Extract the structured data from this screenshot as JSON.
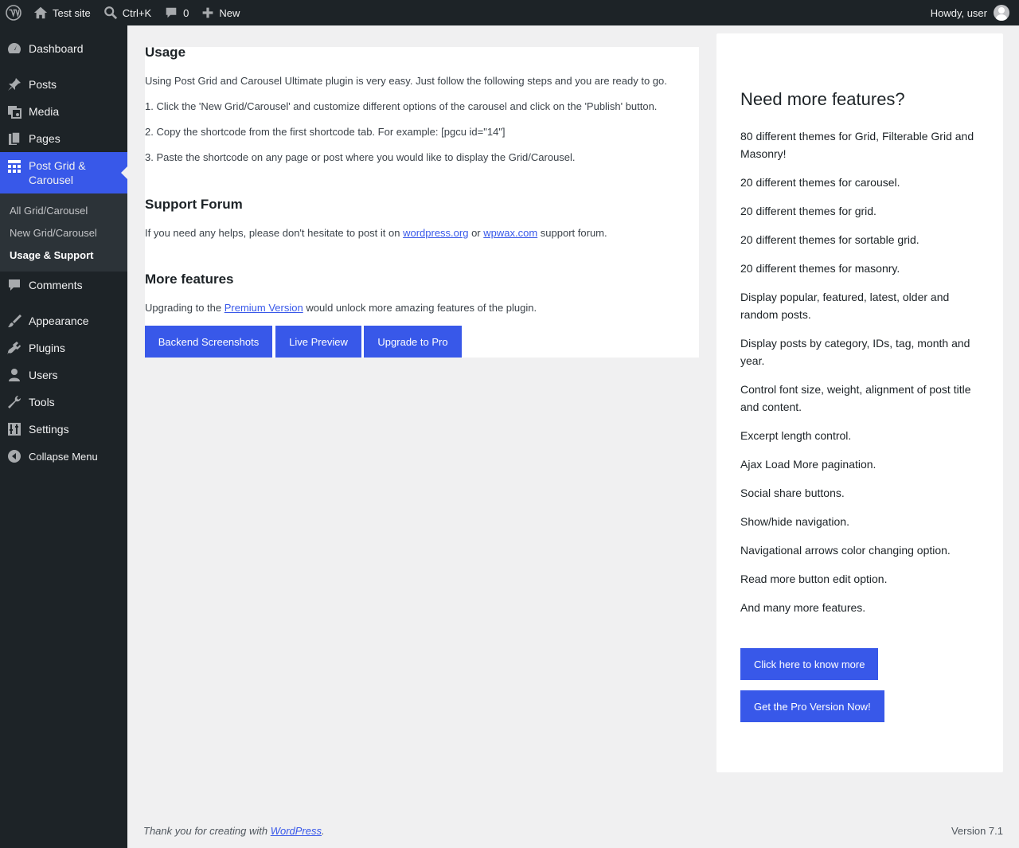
{
  "admin_bar": {
    "site_name": "Test site",
    "search_shortcut": "Ctrl+K",
    "comments_count": "0",
    "new_label": "New",
    "howdy": "Howdy, user"
  },
  "sidebar": {
    "items": [
      {
        "label": "Dashboard",
        "icon": "dashboard-icon"
      },
      {
        "label": "Posts",
        "icon": "pin-icon"
      },
      {
        "label": "Media",
        "icon": "media-icon"
      },
      {
        "label": "Pages",
        "icon": "pages-icon"
      },
      {
        "label": "Post Grid & Carousel",
        "icon": "grid-icon"
      },
      {
        "label": "Comments",
        "icon": "comment-icon"
      },
      {
        "label": "Appearance",
        "icon": "brush-icon"
      },
      {
        "label": "Plugins",
        "icon": "plugin-icon"
      },
      {
        "label": "Users",
        "icon": "user-icon"
      },
      {
        "label": "Tools",
        "icon": "wrench-icon"
      },
      {
        "label": "Settings",
        "icon": "settings-icon"
      },
      {
        "label": "Collapse Menu",
        "icon": "collapse-icon"
      }
    ],
    "submenu": [
      "All Grid/Carousel",
      "New Grid/Carousel",
      "Usage & Support"
    ]
  },
  "usage": {
    "title": "Usage",
    "intro": "Using Post Grid and Carousel Ultimate plugin is very easy. Just follow the following steps and you are ready to go.",
    "step1": "1. Click the 'New Grid/Carousel' and customize different options of the carousel and click on the 'Publish' button.",
    "step2": "2. Copy the shortcode from the first shortcode tab. For example: [pgcu id=\"14\"]",
    "step3": "3. Paste the shortcode on any page or post where you would like to display the Grid/Carousel."
  },
  "support": {
    "title": "Support Forum",
    "text_before": "If you need any helps, please don't hesitate to post it on ",
    "link1": "wordpress.org",
    "text_mid": " or ",
    "link2": "wpwax.com",
    "text_after": " support forum."
  },
  "more": {
    "title": "More features",
    "text_before": "Upgrading to the ",
    "link": "Premium Version",
    "text_after": " would unlock more amazing features of the plugin.",
    "buttons": [
      "Backend Screenshots",
      "Live Preview",
      "Upgrade to Pro"
    ]
  },
  "features_panel": {
    "title": "Need more features?",
    "items": [
      "80 different themes for Grid, Filterable Grid and Masonry!",
      "20 different themes for carousel.",
      "20 different themes for grid.",
      "20 different themes for sortable grid.",
      "20 different themes for masonry.",
      "Display popular, featured, latest, older and random posts.",
      "Display posts by category, IDs, tag, month and year.",
      "Control font size, weight, alignment of post title and content.",
      "Excerpt length control.",
      "Ajax Load More pagination.",
      "Social share buttons.",
      "Show/hide navigation.",
      "Navigational arrows color changing option.",
      "Read more button edit option.",
      "And many more features."
    ],
    "btn_know_more": "Click here to know more",
    "btn_pro": "Get the Pro Version Now!"
  },
  "footer": {
    "text_before": "Thank you for creating with ",
    "link": "WordPress",
    "text_after": ".",
    "version": "Version 7.1"
  },
  "colors": {
    "accent": "#3858e9",
    "admin_dark": "#1d2327",
    "background": "#f0f0f1"
  }
}
